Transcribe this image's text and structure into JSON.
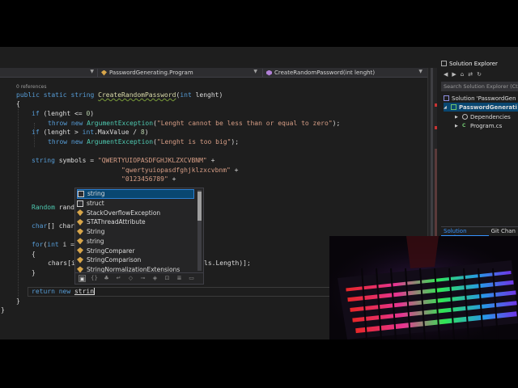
{
  "editor": {
    "nav_project": "",
    "nav_class": "PasswordGenerating.Program",
    "nav_member": "CreateRandomPassword(int lenght)",
    "references": "0 references",
    "lines": {
      "signature": {
        "mod": "public static ",
        "type": "string ",
        "name": "CreateRandomPassword",
        "open": "(",
        "ptype": "int",
        "pname": " lenght)"
      },
      "brace_open": "{",
      "if1": {
        "kw": "if",
        "rest1": " (lenght <= ",
        "num": "0",
        "rest2": ")"
      },
      "throw1": {
        "kw1": "throw ",
        "kw2": "new ",
        "ty": "ArgumentException",
        "open": "(",
        "str": "\"Lenght cannot be less than or equal to zero\"",
        "close": ");"
      },
      "if2": {
        "kw": "if",
        "rest1": " (lenght > ",
        "kw2": "int",
        "rest2": ".MaxValue / ",
        "num": "8",
        "rest3": ")"
      },
      "throw2": {
        "kw1": "throw ",
        "kw2": "new ",
        "ty": "ArgumentException",
        "open": "(",
        "str": "\"Lenght is too big\"",
        "close": ");"
      },
      "symbols": {
        "kw": "string ",
        "rest": "symbols = ",
        "str": "\"QWERTYUIOPASDFGHJKLZXCVBNM\"",
        "plus": " +"
      },
      "lower": {
        "str": "\"qwertyuiopasdfghjklzxcvbnm\"",
        "plus": " +"
      },
      "digits": {
        "str": "\"0123456789\"",
        "plus": " +"
      },
      "random": {
        "ty": "Random ",
        "rest": "rand"
      },
      "chars": {
        "kw": "char",
        "rest": "[] char"
      },
      "for": {
        "kw1": "for",
        "open": "(",
        "kw2": "int",
        "rest": " i ="
      },
      "inner_brace_open": "{",
      "assign": {
        "rest": "chars[i"
      },
      "assign_tail": "ls.Length)];",
      "inner_brace_close": "}",
      "return": {
        "kw1": "return ",
        "kw2": "new ",
        "rest": "strin"
      },
      "brace_close_inner": "}",
      "brace_close_outer": "}"
    }
  },
  "completion": {
    "items": [
      {
        "label": "string",
        "icon": "keyword-icon",
        "selected": true
      },
      {
        "label": "struct",
        "icon": "keyword-icon"
      },
      {
        "label": "StackOverflowException",
        "icon": "class-icon"
      },
      {
        "label": "STAThreadAttribute",
        "icon": "class-icon"
      },
      {
        "label": "String",
        "icon": "class-icon"
      },
      {
        "label": "string",
        "icon": "class-icon"
      },
      {
        "label": "StringComparer",
        "icon": "class-icon"
      },
      {
        "label": "StringComparison",
        "icon": "enum-icon"
      },
      {
        "label": "StringNormalizationExtensions",
        "icon": "class-icon"
      }
    ],
    "filters": [
      "▣",
      "{}",
      "♣",
      "↵",
      "◇",
      "⊸",
      "◈",
      "⊡",
      "≣",
      "▭"
    ]
  },
  "solution_explorer": {
    "title": "Solution Explorer",
    "search_placeholder": "Search Solution Explorer (Ct",
    "tree": [
      {
        "label": "Solution 'PasswordGen",
        "level": 0,
        "icon": "solution-icon"
      },
      {
        "label": "PasswordGenerati",
        "level": 1,
        "icon": "csharp-project-icon"
      },
      {
        "label": "Dependencies",
        "level": 2,
        "icon": "dependencies-icon"
      },
      {
        "label": "Program.cs",
        "level": 2,
        "icon": "csharp-file-icon"
      }
    ],
    "tabs": [
      "Solution Explorer",
      "Git Chan"
    ]
  },
  "colors": {
    "keyword": "#569cd6",
    "type": "#4ec9b0",
    "method": "#dcdcaa",
    "string": "#d69d85",
    "number": "#b5cea8",
    "selection": "#094771"
  }
}
